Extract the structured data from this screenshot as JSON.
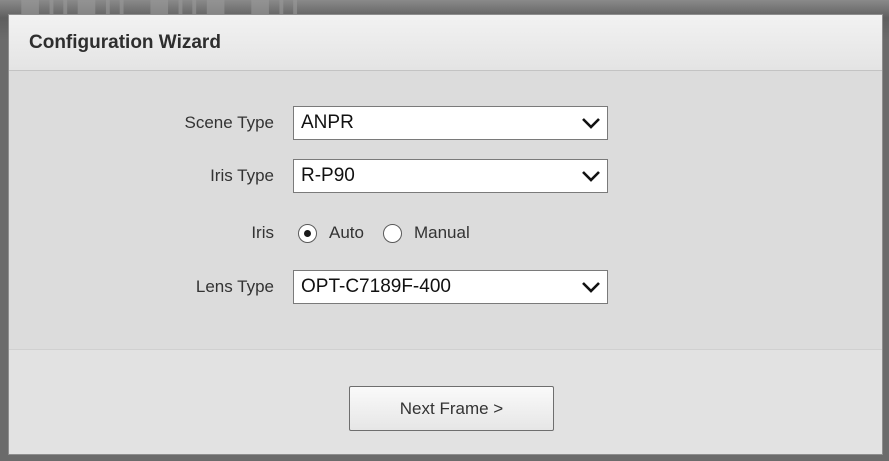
{
  "dialog": {
    "title": "Configuration Wizard"
  },
  "form": {
    "scene_type": {
      "label": "Scene Type",
      "value": "ANPR"
    },
    "iris_type": {
      "label": "Iris Type",
      "value": "R-P90"
    },
    "iris": {
      "label": "Iris",
      "options": [
        "Auto",
        "Manual"
      ],
      "selected": "Auto"
    },
    "lens_type": {
      "label": "Lens Type",
      "value": "OPT-C7189F-400"
    }
  },
  "footer": {
    "next_label": "Next Frame >"
  },
  "icons": {
    "dropdown": "chevron-down-icon",
    "radio_checked": "radio-checked-icon",
    "radio_unchecked": "radio-unchecked-icon"
  }
}
